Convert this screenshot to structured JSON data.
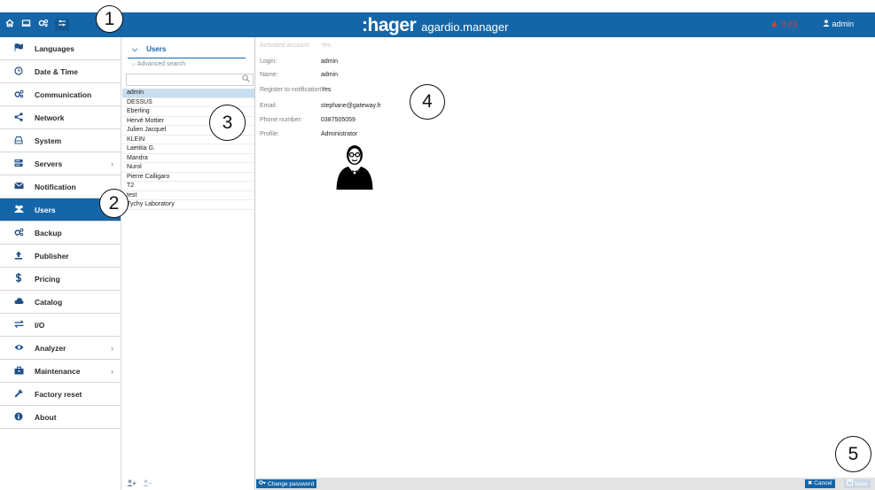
{
  "topbar": {
    "icons": [
      "home-icon",
      "monitor-icon",
      "cogs-icon",
      "sliders-icon"
    ],
    "logo": ":hager",
    "product": "agardio.manager",
    "alert_count": "0 (0)",
    "user": "admin",
    "color": "#1466a8",
    "alert_color": "#e63c2f"
  },
  "sidebar": {
    "items": [
      {
        "label": "Languages",
        "icon": "flag-icon",
        "has_children": false
      },
      {
        "label": "Date & Time",
        "icon": "clock-icon",
        "has_children": false
      },
      {
        "label": "Communication",
        "icon": "cogs-icon",
        "has_children": false
      },
      {
        "label": "Network",
        "icon": "share-icon",
        "has_children": false
      },
      {
        "label": "System",
        "icon": "hdd-icon",
        "has_children": false
      },
      {
        "label": "Servers",
        "icon": "server-icon",
        "has_children": true
      },
      {
        "label": "Notification",
        "icon": "envelope-icon",
        "has_children": false
      },
      {
        "label": "Users",
        "icon": "users-icon",
        "has_children": false,
        "active": true
      },
      {
        "label": "Backup",
        "icon": "cogs-icon",
        "has_children": false
      },
      {
        "label": "Publisher",
        "icon": "upload-icon",
        "has_children": false
      },
      {
        "label": "Pricing",
        "icon": "dollar-icon",
        "has_children": false
      },
      {
        "label": "Catalog",
        "icon": "cloud-icon",
        "has_children": false
      },
      {
        "label": "I/O",
        "icon": "exchange-icon",
        "has_children": false
      },
      {
        "label": "Analyzer",
        "icon": "eye-icon",
        "has_children": true
      },
      {
        "label": "Maintenance",
        "icon": "toolbox-icon",
        "has_children": true
      },
      {
        "label": "Factory reset",
        "icon": "wrench-icon",
        "has_children": false
      },
      {
        "label": "About",
        "icon": "info-icon",
        "has_children": false
      }
    ]
  },
  "users_panel": {
    "title": "Users",
    "advanced_search": "Advanced search",
    "search_value": "",
    "users": [
      "admin",
      "DESSUS",
      "Eberling",
      "Hervé Mottier",
      "Julien Jacquel",
      "KLEIN",
      "Laetitia G.",
      "Mandra",
      "Nurol",
      "Pierre Calligaro",
      "T2",
      "test",
      "Tychy Laboratory"
    ],
    "selected_index": 0
  },
  "detail": {
    "fields": [
      {
        "label": "Activated account:",
        "value": "Yes",
        "dim": true
      },
      {
        "label": "Login:",
        "value": "admin"
      },
      {
        "label": "Name:",
        "value": "admin"
      },
      {
        "label": "Register to notification:",
        "value": "Yes"
      },
      {
        "label": "Email:",
        "value": "stephane@gateway.fr"
      },
      {
        "label": "Phone number:",
        "value": "0387505059"
      },
      {
        "label": "Profile:",
        "value": "Administrator"
      }
    ]
  },
  "actions": {
    "change_password": "Change password",
    "cancel": "Cancel",
    "save": "Save"
  },
  "markers": [
    "1",
    "2",
    "3",
    "4",
    "5"
  ]
}
